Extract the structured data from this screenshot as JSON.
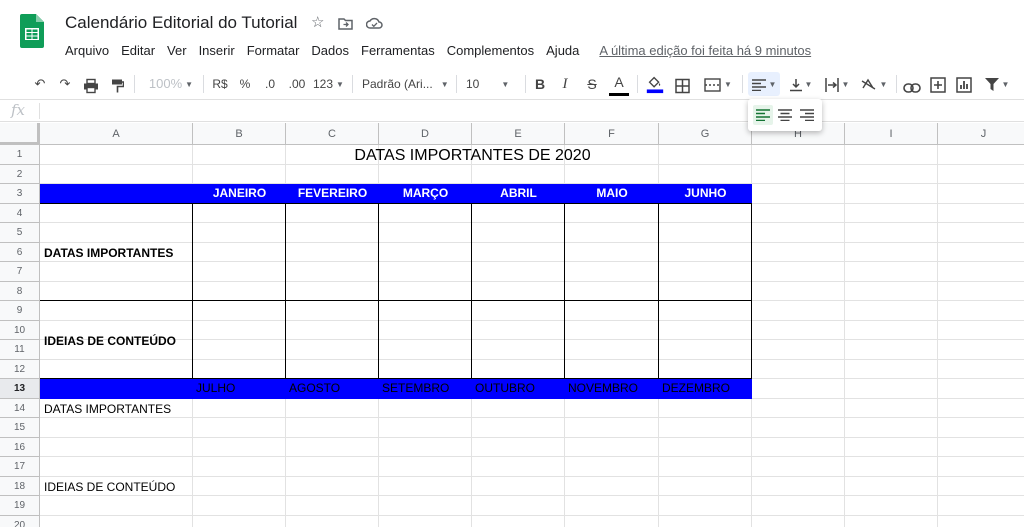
{
  "app": {
    "doc_title": "Calendário Editorial do Tutorial",
    "icons": [
      "star-icon",
      "move-to-folder-icon",
      "cloud-status-icon"
    ],
    "brand_color": "#0f9d58"
  },
  "menu": {
    "items": [
      "Arquivo",
      "Editar",
      "Ver",
      "Inserir",
      "Formatar",
      "Dados",
      "Ferramentas",
      "Complementos",
      "Ajuda"
    ],
    "last_edit": "A última edição foi feita há 9 minutos"
  },
  "toolbar": {
    "zoom": "100%",
    "currency": "R$",
    "percent": "%",
    "decrease_decimals": ".0",
    "increase_decimals": ".00",
    "more_formats": "123",
    "font": "Padrão (Ari...",
    "font_size": "10",
    "bold": "B",
    "italic": "I",
    "strike": "S",
    "text_color": "A"
  },
  "formula_bar": {
    "fx": "fx",
    "value": ""
  },
  "columns": [
    "A",
    "B",
    "C",
    "D",
    "E",
    "F",
    "G",
    "H",
    "I",
    "J"
  ],
  "rows": [
    "1",
    "2",
    "3",
    "4",
    "5",
    "6",
    "7",
    "8",
    "9",
    "10",
    "11",
    "12",
    "13",
    "14",
    "15",
    "16",
    "17",
    "18",
    "19",
    "20"
  ],
  "selected_row": "13",
  "sheet": {
    "title": "DATAS IMPORTANTES DE 2020",
    "months_first_half": [
      "JANEIRO",
      "FEVEREIRO",
      "MARÇO",
      "ABRIL",
      "MAIO",
      "JUNHO"
    ],
    "months_second_half": [
      "JULHO",
      "AGOSTO",
      "SETEMBRO",
      "OUTUBRO",
      "NOVEMBRO",
      "DEZEMBRO"
    ],
    "label_dates": "DATAS IMPORTANTES",
    "label_ideas": "IDEIAS DE CONTEÚDO",
    "label_dates_2": "DATAS IMPORTANTES",
    "label_ideas_2": "IDEIAS DE CONTEÚDO",
    "band_color": "#0000ff"
  }
}
